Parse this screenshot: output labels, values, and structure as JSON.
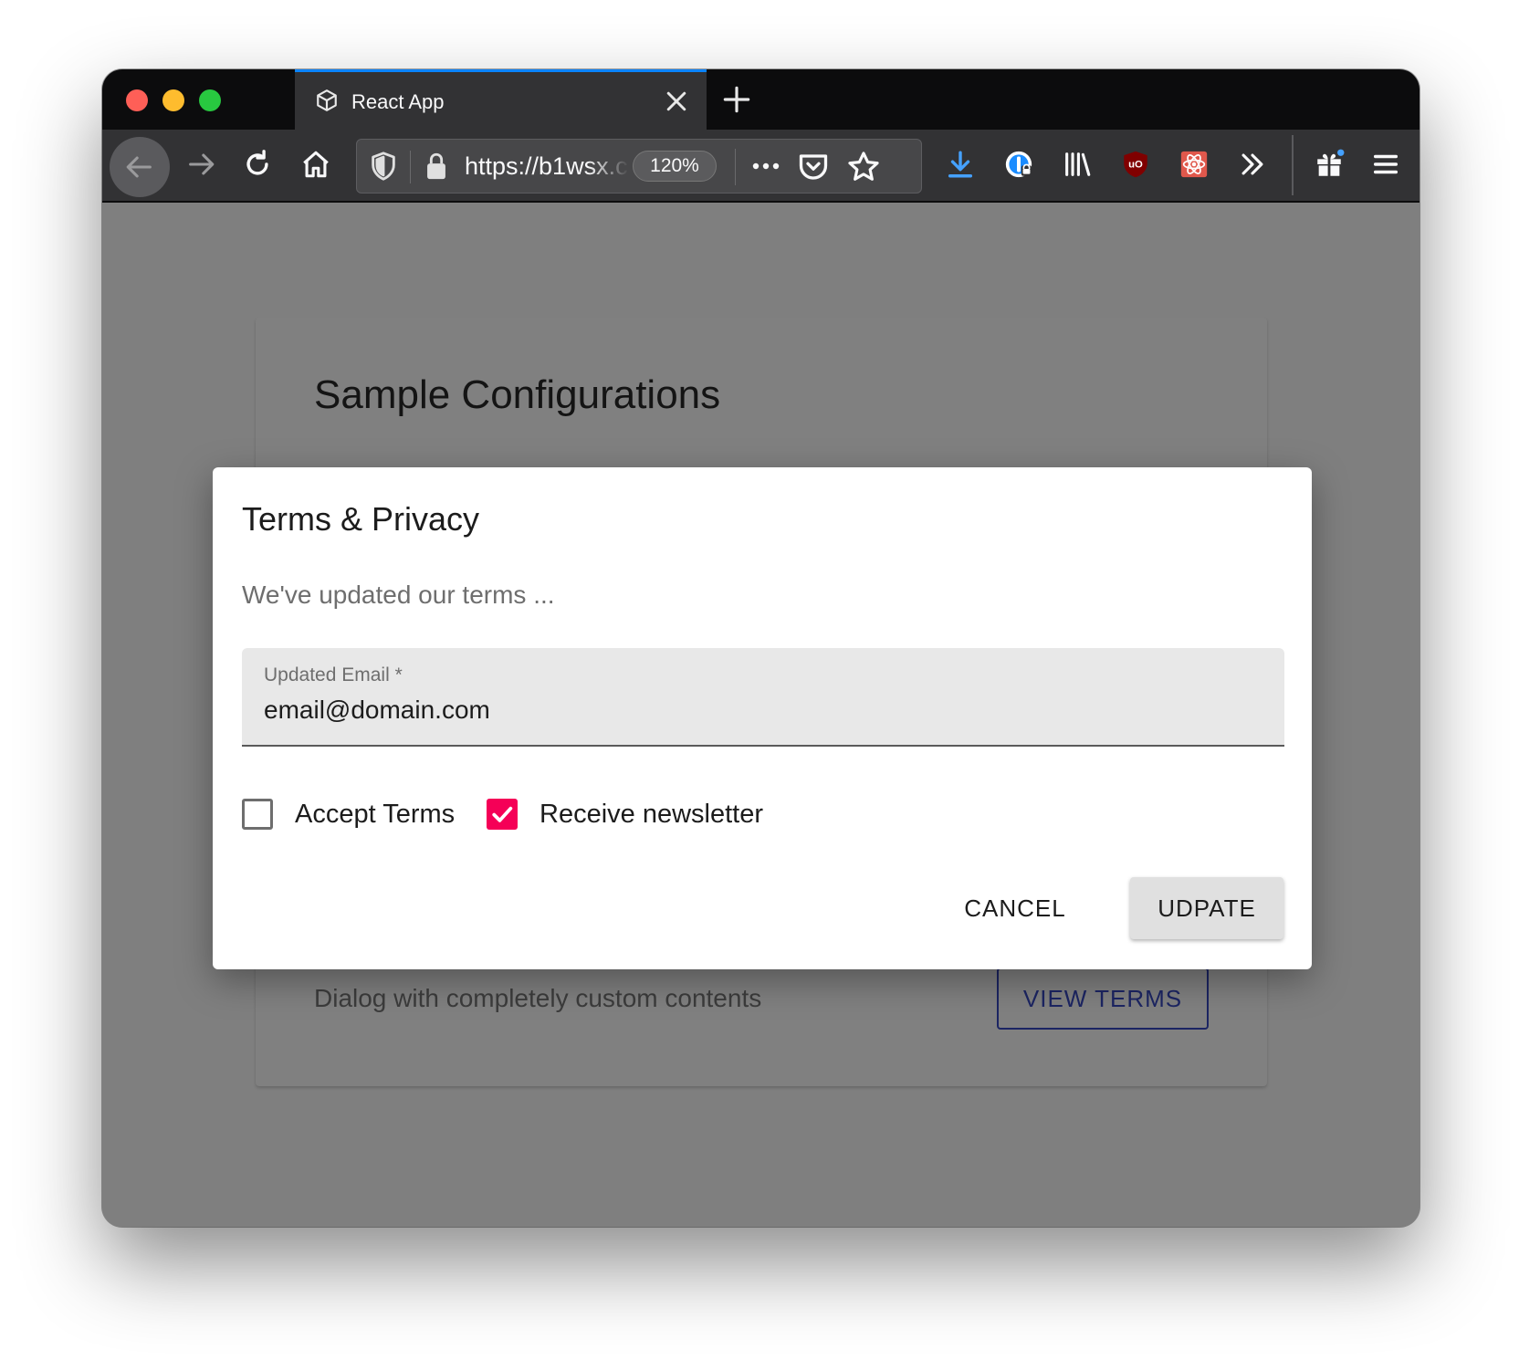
{
  "browser": {
    "tab": {
      "title": "React App"
    },
    "url": {
      "text": "https://b1wsx.c",
      "zoom": "120%"
    }
  },
  "page": {
    "card_title": "Sample Configurations",
    "card_description": "Dialog with completely custom contents",
    "view_terms_label": "VIEW TERMS"
  },
  "dialog": {
    "title": "Terms & Privacy",
    "text": "We've updated our terms ...",
    "email": {
      "label": "Updated Email",
      "required_mark": " *",
      "value": "email@domain.com"
    },
    "checkboxes": [
      {
        "label": "Accept Terms",
        "checked": false
      },
      {
        "label": "Receive newsletter",
        "checked": true
      }
    ],
    "cancel_label": "CANCEL",
    "update_label": "UDPATE"
  },
  "colors": {
    "accent_secondary": "#f50057",
    "primary": "#1c2563",
    "tab_highlight": "#0a84ff"
  },
  "icons": [
    "back-icon",
    "forward-icon",
    "reload-icon",
    "home-icon",
    "shield-icon",
    "lock-icon",
    "more-icon",
    "pocket-icon",
    "star-icon",
    "download-icon",
    "onepassword-icon",
    "library-icon",
    "ublock-icon",
    "react-devtools-icon",
    "overflow-icon",
    "gift-icon",
    "menu-icon",
    "close-icon",
    "plus-icon",
    "cube-icon",
    "check-icon"
  ]
}
